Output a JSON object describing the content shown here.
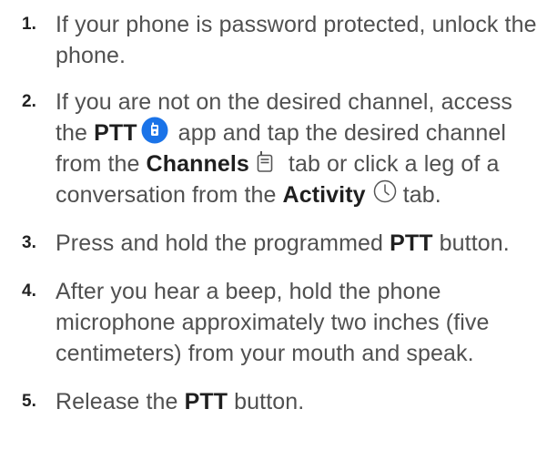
{
  "steps": [
    {
      "number": "1.",
      "text": "If your phone is password protected, unlock the phone."
    },
    {
      "number": "2.",
      "text_a": "If you are not on the desired channel, access the ",
      "bold_a": "PTT",
      "text_b": " app and tap the desired channel from the ",
      "bold_b": "Channels",
      "text_c": " tab or click a leg of a conversation from the ",
      "bold_c": "Activity",
      "text_d": " tab."
    },
    {
      "number": "3.",
      "text_a": "Press and hold the programmed ",
      "bold_a": "PTT",
      "text_b": " button."
    },
    {
      "number": "4.",
      "text": "After you hear a beep, hold the phone microphone approximately two inches (five centimeters) from your mouth and speak."
    },
    {
      "number": "5.",
      "text_a": "Release the ",
      "bold_a": "PTT",
      "text_b": " button."
    }
  ],
  "icons": {
    "ptt_app": "ptt-app-icon",
    "channels_tab": "walkie-talkie-icon",
    "activity_tab": "clock-icon"
  },
  "colors": {
    "text": "#505050",
    "bold_text": "#1f1f1f",
    "ptt_icon": "#1a73e8"
  }
}
